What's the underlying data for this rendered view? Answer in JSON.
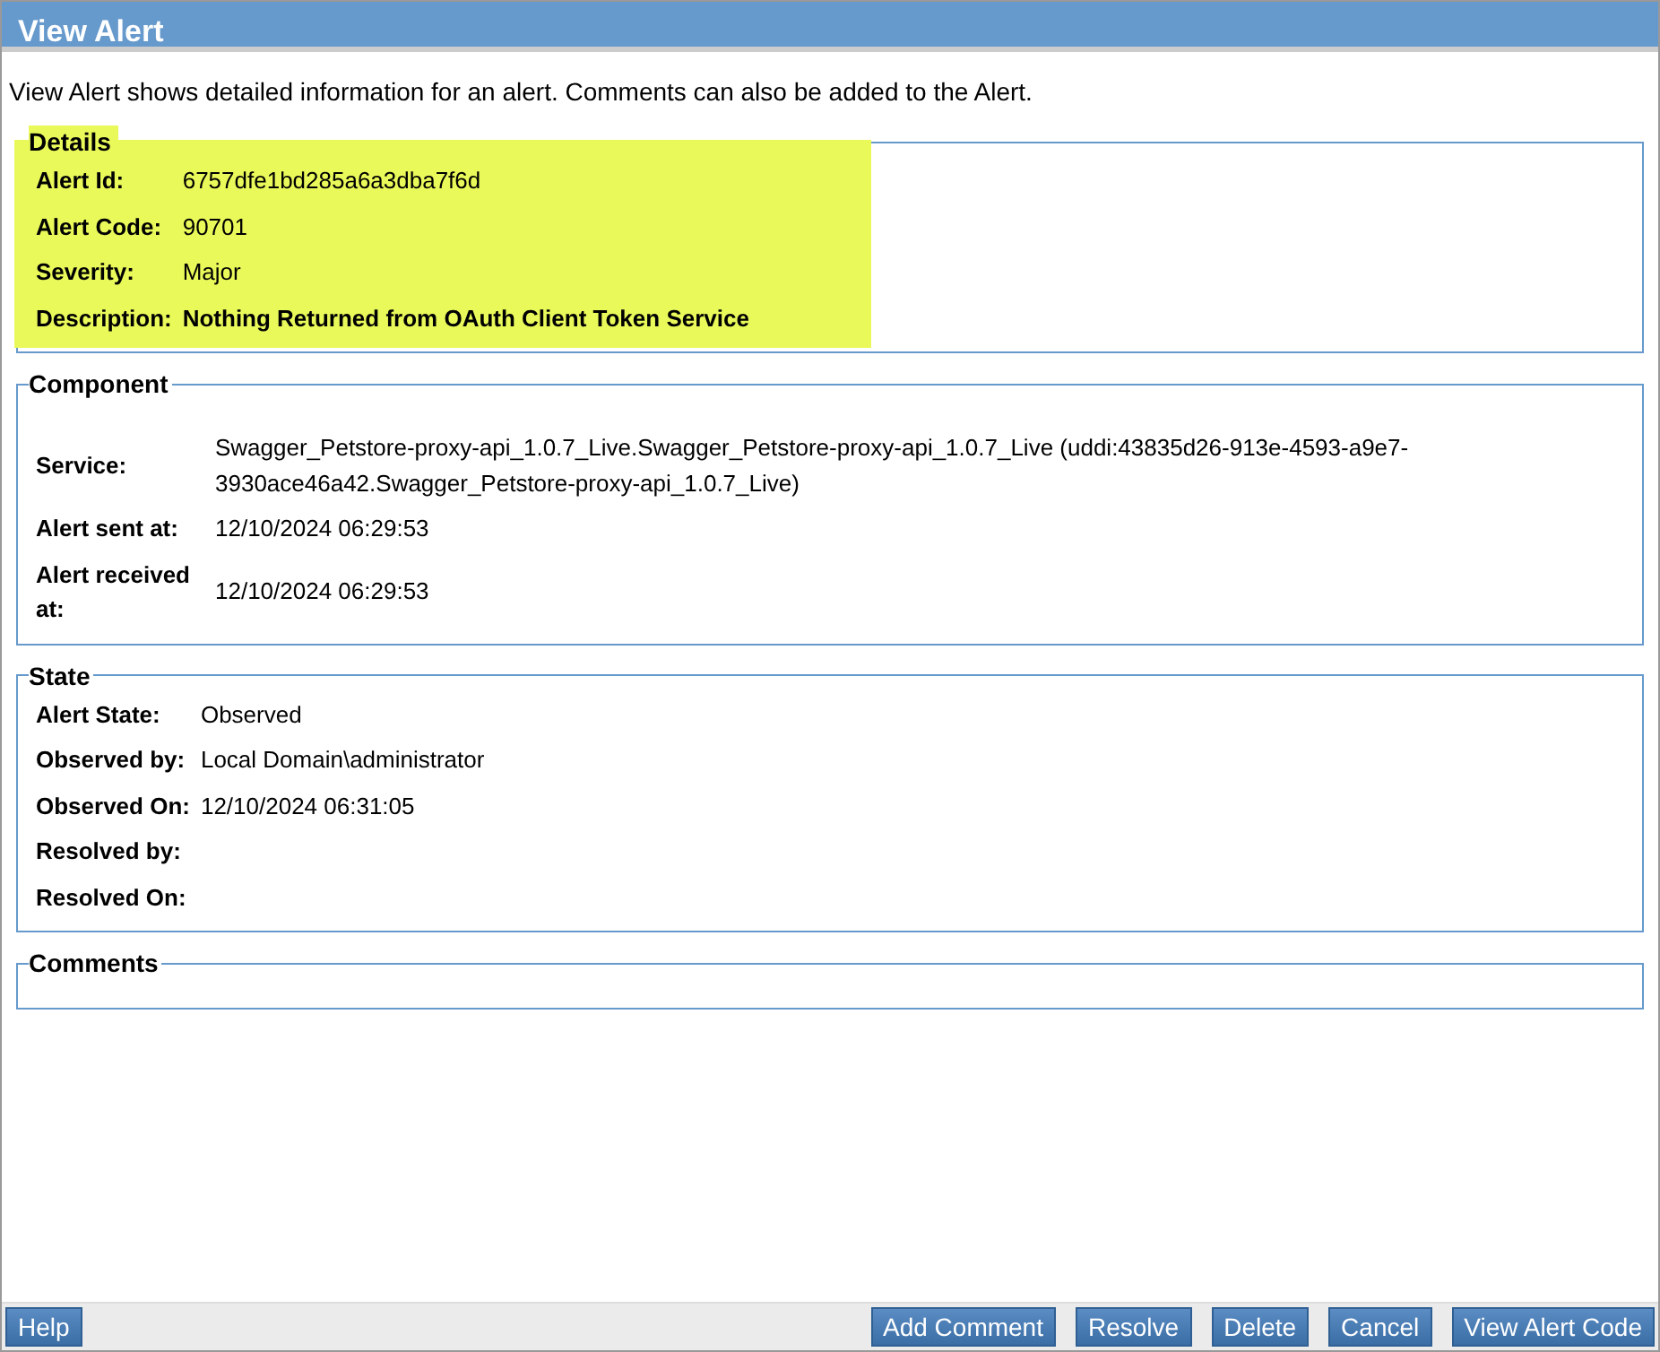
{
  "header": {
    "title": "View Alert"
  },
  "intro": "View Alert shows detailed information for an alert. Comments can also be added to the Alert.",
  "sections": [
    {
      "title": "Details",
      "highlighted": true,
      "rows": [
        {
          "label": "Alert Id:",
          "value": "6757dfe1bd285a6a3dba7f6d"
        },
        {
          "label": "Alert Code:",
          "value": "90701"
        },
        {
          "label": "Severity:",
          "value": "Major"
        },
        {
          "label": "Description:",
          "value": "Nothing Returned from OAuth Client Token Service",
          "bold": true
        }
      ]
    },
    {
      "title": "Component",
      "highlighted": false,
      "rows": [
        {
          "label": "Service:",
          "value": "Swagger_Petstore-proxy-api_1.0.7_Live.Swagger_Petstore-proxy-api_1.0.7_Live (uddi:43835d26-913e-4593-a9e7-3930ace46a42.Swagger_Petstore-proxy-api_1.0.7_Live)"
        },
        {
          "label": "Alert sent at:",
          "value": "12/10/2024 06:29:53"
        },
        {
          "label": "Alert received at:",
          "value": "12/10/2024 06:29:53"
        }
      ]
    },
    {
      "title": "State",
      "highlighted": false,
      "rows": [
        {
          "label": "Alert State:",
          "value": "Observed"
        },
        {
          "label": "Observed by:",
          "value": "Local Domain\\administrator"
        },
        {
          "label": "Observed On:",
          "value": "12/10/2024 06:31:05"
        },
        {
          "label": "Resolved by:"
        },
        {
          "label": "Resolved On:"
        }
      ]
    },
    {
      "title": "Comments",
      "highlighted": false
    }
  ],
  "footer": {
    "left_buttons": [
      "Help"
    ],
    "right_buttons": [
      "Add Comment",
      "Resolve",
      "Delete",
      "Cancel",
      "View Alert Code"
    ]
  }
}
